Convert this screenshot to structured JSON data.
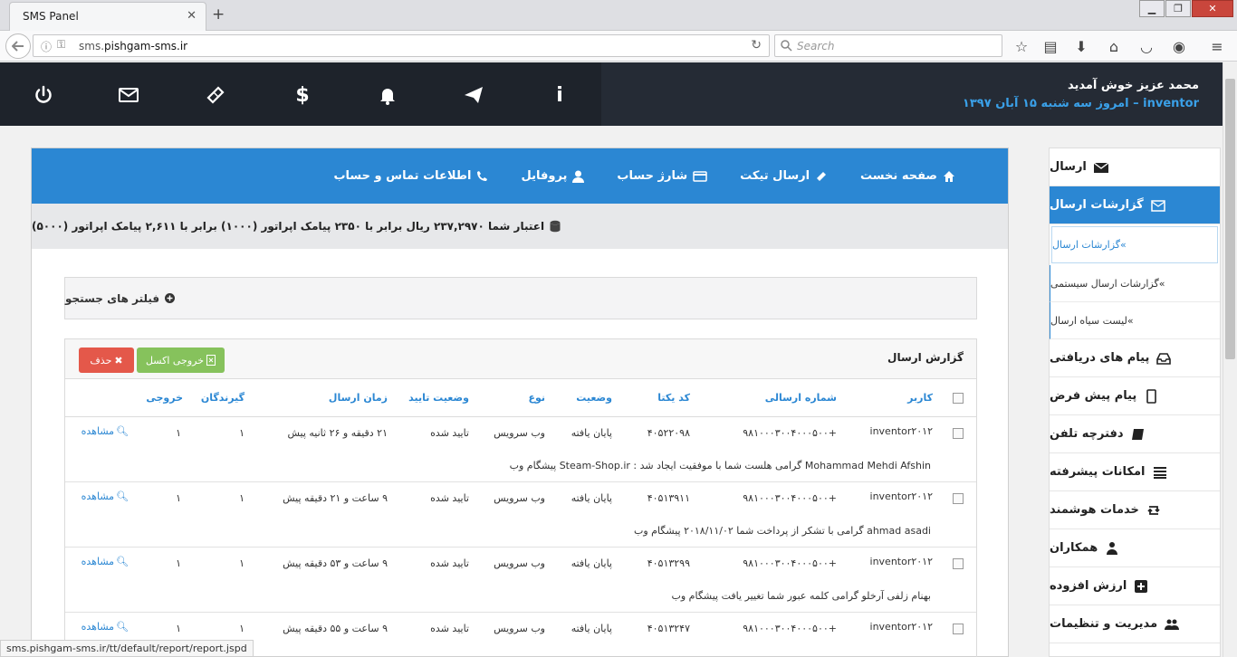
{
  "browser": {
    "tab_title": "SMS Panel",
    "url_domain_prefix": "sms.",
    "url_domain": "pishgam-sms.ir",
    "search_placeholder": "Search",
    "status_url": "sms.pishgam-sms.ir/tt/default/report/report.jspd"
  },
  "header": {
    "welcome": "محمد عزیز خوش آمدید",
    "username": "inventor",
    "date_text": "– امروز سه شنبه ۱۵ آبان ۱۳۹۷",
    "icons": [
      "power-icon",
      "envelope-icon",
      "ticket-icon",
      "dollar-icon",
      "bell-icon",
      "send-icon",
      "info-icon"
    ]
  },
  "topnav": [
    {
      "label": "صفحه نخست",
      "icon": "home-icon"
    },
    {
      "label": "ارسال تیکت",
      "icon": "ticket-icon"
    },
    {
      "label": "شارژ حساب",
      "icon": "credit-card-icon"
    },
    {
      "label": "پروفایل",
      "icon": "user-icon"
    },
    {
      "label": "اطلاعات تماس و حساب",
      "icon": "phone-icon"
    }
  ],
  "credit_text": "اعتبار شما ۲۳۷,۲۹۷۰ ریال برابر با ۲۳۵۰ پیامک اپراتور (۱۰۰۰) برابر با ۲,۶۱۱ پیامک اپراتور (۵۰۰۰)",
  "filter_label": "فیلتر های جستجو",
  "report": {
    "title": "گزارش ارسال",
    "excel_label": "خروجی اکسل",
    "delete_label": "حذف",
    "columns": {
      "user": "کاربر",
      "sender": "شماره ارسالی",
      "code": "کد یکتا",
      "status": "وضعیت",
      "type": "نوع",
      "confirm": "وضعیت تایید",
      "time": "زمان ارسال",
      "recipients": "گیرندگان",
      "output": "خروجی"
    },
    "view_label": "مشاهده",
    "rows": [
      {
        "user": "inventor۲۰۱۲",
        "sender": "+۹۸۱۰۰۰۳۰۰۴۰۰۰۵۰۰",
        "code": "۴۰۵۲۲۰۹۸",
        "status": "پایان یافته",
        "type": "وب سرویس",
        "confirm": "تایید شده",
        "time": "۲۱ دقیقه و ۲۶ ثانیه پیش",
        "recipients": "۱",
        "output": "۱",
        "message": "Mohammad Mehdi Afshin گرامی هلست شما با موفقیت ایجاد شد : Steam-Shop.ir پیشگام وب"
      },
      {
        "user": "inventor۲۰۱۲",
        "sender": "+۹۸۱۰۰۰۳۰۰۴۰۰۰۵۰۰",
        "code": "۴۰۵۱۳۹۱۱",
        "status": "پایان یافته",
        "type": "وب سرویس",
        "confirm": "تایید شده",
        "time": "۹ ساعت و ۲۱ دقیقه پیش",
        "recipients": "۱",
        "output": "۱",
        "message": "ahmad asadi گرامی با تشکر از پرداخت شما ۲۰۱۸/۱۱/۰۲ پیشگام وب"
      },
      {
        "user": "inventor۲۰۱۲",
        "sender": "+۹۸۱۰۰۰۳۰۰۴۰۰۰۵۰۰",
        "code": "۴۰۵۱۳۲۹۹",
        "status": "پایان یافته",
        "type": "وب سرویس",
        "confirm": "تایید شده",
        "time": "۹ ساعت و ۵۳ دقیقه پیش",
        "recipients": "۱",
        "output": "۱",
        "message": "بهنام زلفی آرخلو گرامی کلمه عبور شما تغییر یافت پیشگام وب"
      },
      {
        "user": "inventor۲۰۱۲",
        "sender": "+۹۸۱۰۰۰۳۰۰۴۰۰۰۵۰۰",
        "code": "۴۰۵۱۳۲۴۷",
        "status": "پایان یافته",
        "type": "وب سرویس",
        "confirm": "تایید شده",
        "time": "۹ ساعت و ۵۵ دقیقه پیش",
        "recipients": "۱",
        "output": "۱",
        "message": ""
      }
    ]
  },
  "sidebar": {
    "items": [
      {
        "label": "ارسال",
        "icon": "envelope-icon"
      },
      {
        "label": "گزارشات ارسال",
        "icon": "envelope-open-icon",
        "active": true
      },
      {
        "label": "پیام های دریافتی",
        "icon": "inbox-icon"
      },
      {
        "label": "پیام پیش فرض",
        "icon": "mobile-icon"
      },
      {
        "label": "دفترچه تلفن",
        "icon": "book-icon"
      },
      {
        "label": "امکانات پیشرفته",
        "icon": "list-icon"
      },
      {
        "label": "خدمات هوشمند",
        "icon": "retweet-icon"
      },
      {
        "label": "همکاران",
        "icon": "users-icon"
      },
      {
        "label": "ارزش افزوده",
        "icon": "plus-square-icon"
      },
      {
        "label": "مدیریت و تنظیمات",
        "icon": "group-icon"
      }
    ],
    "subitems": [
      {
        "label": "گزارشات ارسال"
      },
      {
        "label": "گزارشات ارسال سیستمی"
      },
      {
        "label": "لیست سیاه ارسال"
      }
    ]
  }
}
